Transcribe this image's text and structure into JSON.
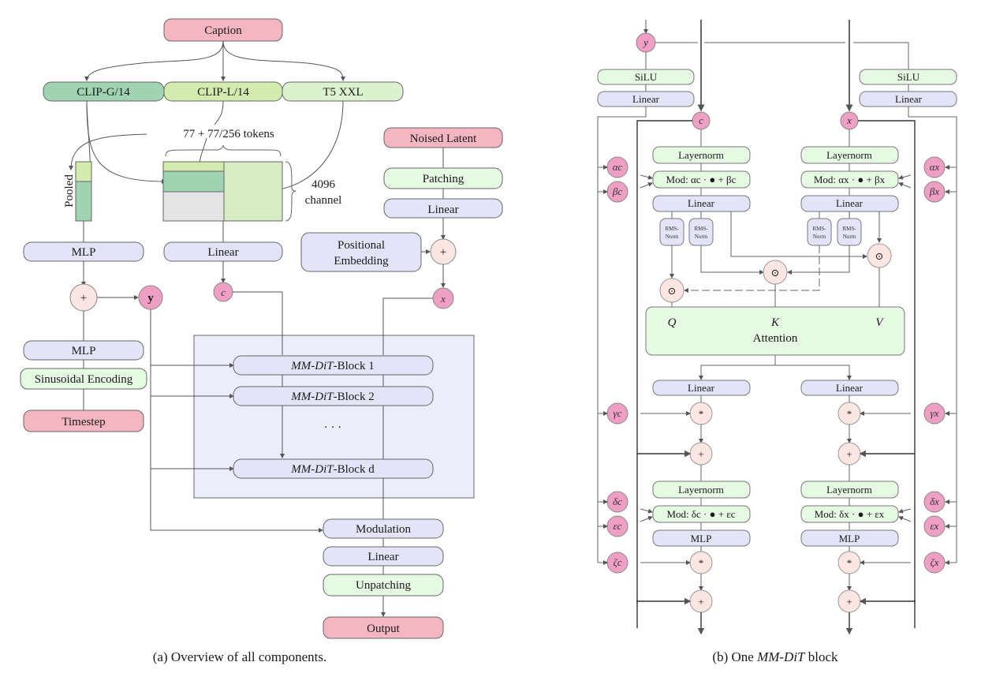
{
  "colors": {
    "pink": "#f4b6c0",
    "pink_circle": "#ee9fc3",
    "green_dark": "#9fd3b2",
    "green_mid": "#d4ebb0",
    "green_light": "#dcf2cf",
    "green_pale": "#e6f9e3",
    "lavender": "#e3e4f8",
    "op_circle": "#fbe6e2",
    "block_bg": "#ececfa",
    "stroke": "#555555",
    "gray": "#e4e4e4"
  },
  "panel_a": {
    "caption": "(a) Overview of all components.",
    "caption_box": "Caption",
    "encoders": [
      "CLIP-G/14",
      "CLIP-L/14",
      "T5 XXL"
    ],
    "tokens_label": "77 + 77/256 tokens",
    "channel_label_1": "4096",
    "channel_label_2": "channel",
    "pooled_label": "Pooled",
    "mlp_top": "MLP",
    "linear_c": "Linear",
    "noised_latent": "Noised Latent",
    "patching": "Patching",
    "linear_x": "Linear",
    "pos_emb_1": "Positional",
    "pos_emb_2": "Embedding",
    "plus": "+",
    "y_label": "y",
    "c_label": "c",
    "x_label": "x",
    "mlp_bottom": "MLP",
    "sinusoidal": "Sinusoidal Encoding",
    "timestep": "Timestep",
    "blocks": [
      {
        "italic": "MM-DiT",
        "rest": "-Block 1"
      },
      {
        "italic": "MM-DiT",
        "rest": "-Block 2"
      },
      {
        "italic": "MM-DiT",
        "rest": "-Block d"
      }
    ],
    "ellipsis": "· · ·",
    "modulation": "Modulation",
    "linear_out": "Linear",
    "unpatching": "Unpatching",
    "output": "Output"
  },
  "panel_b": {
    "caption_prefix": "(b) One ",
    "caption_italic": "MM-DiT",
    "caption_suffix": " block",
    "y_label": "y",
    "c_label": "c",
    "x_label": "x",
    "silu": "SiLU",
    "linear": "Linear",
    "layernorm": "Layernorm",
    "mod1_c": "Mod: αc · ● + βc",
    "mod1_x": "Mod: αx · ● + βx",
    "mod2_c": "Mod: δc · ● + εc",
    "mod2_x": "Mod: δx · ● + εx",
    "rms_1": "RMS-",
    "rms_2": "Norm",
    "q": "Q",
    "k": "K",
    "v": "V",
    "attention": "Attention",
    "mlp": "MLP",
    "odot": "⊙",
    "star": "*",
    "plus": "+",
    "params_c": [
      "αc",
      "βc",
      "γc",
      "δc",
      "εc",
      "ζc"
    ],
    "params_x": [
      "αx",
      "βx",
      "γx",
      "δx",
      "εx",
      "ζx"
    ]
  }
}
